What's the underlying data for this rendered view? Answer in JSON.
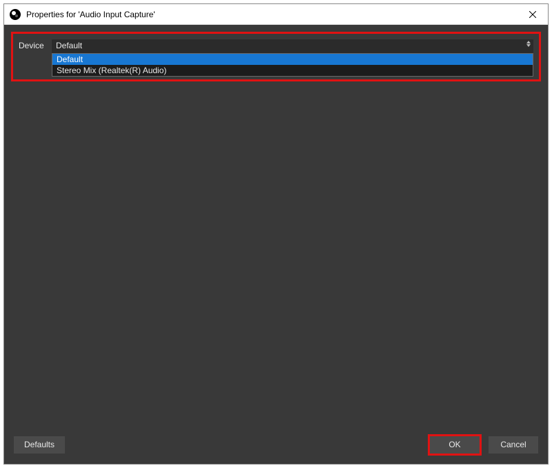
{
  "window": {
    "title": "Properties for 'Audio Input Capture'"
  },
  "device": {
    "label": "Device",
    "selected": "Default",
    "options": [
      "Default",
      "Stereo Mix (Realtek(R) Audio)"
    ]
  },
  "buttons": {
    "defaults": "Defaults",
    "ok": "OK",
    "cancel": "Cancel"
  }
}
